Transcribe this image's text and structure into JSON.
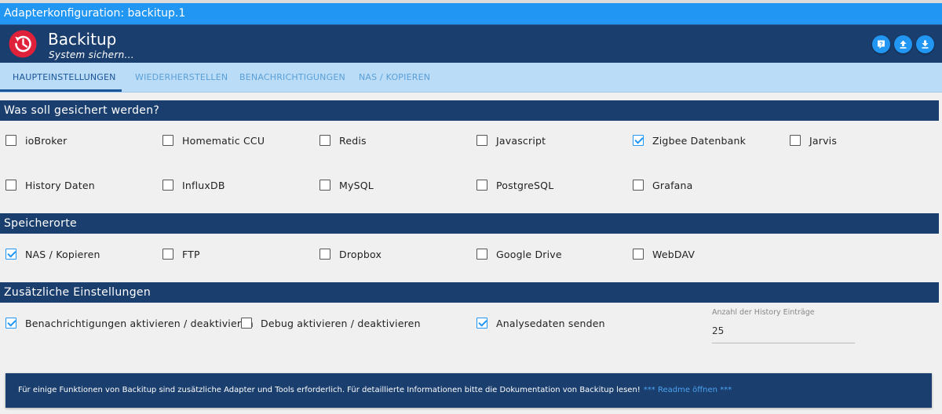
{
  "window_title": "Adapterkonfiguration: backitup.1",
  "app": {
    "name": "Backitup",
    "subtitle": "System sichern..."
  },
  "header_buttons": [
    {
      "icon": "help-icon"
    },
    {
      "icon": "upload-icon"
    },
    {
      "icon": "download-icon"
    }
  ],
  "colors": {
    "accent": "#2196f3",
    "header": "#1a3e6e",
    "tabs_bg": "#bbdcf7",
    "logo": "#e0213a"
  },
  "tabs": [
    {
      "label": "HAUPTEINSTELLUNGEN",
      "active": true
    },
    {
      "label": "WIEDERHERSTELLEN",
      "active": false
    },
    {
      "label": "BENACHRICHTIGUNGEN",
      "active": false
    },
    {
      "label": "NAS / KOPIEREN",
      "active": false
    }
  ],
  "sections": {
    "backup": {
      "title": "Was soll gesichert werden?",
      "options": [
        {
          "label": "ioBroker",
          "checked": false
        },
        {
          "label": "Homematic CCU",
          "checked": false
        },
        {
          "label": "Redis",
          "checked": false
        },
        {
          "label": "Javascript",
          "checked": false
        },
        {
          "label": "Zigbee Datenbank",
          "checked": true
        },
        {
          "label": "Jarvis",
          "checked": false
        },
        {
          "label": "History Daten",
          "checked": false
        },
        {
          "label": "InfluxDB",
          "checked": false
        },
        {
          "label": "MySQL",
          "checked": false
        },
        {
          "label": "PostgreSQL",
          "checked": false
        },
        {
          "label": "Grafana",
          "checked": false
        }
      ]
    },
    "storage": {
      "title": "Speicherorte",
      "options": [
        {
          "label": "NAS / Kopieren",
          "checked": true
        },
        {
          "label": "FTP",
          "checked": false
        },
        {
          "label": "Dropbox",
          "checked": false
        },
        {
          "label": "Google Drive",
          "checked": false
        },
        {
          "label": "WebDAV",
          "checked": false
        }
      ]
    },
    "extra": {
      "title": "Zusätzliche Einstellungen",
      "options": [
        {
          "label": "Benachrichtigungen aktivieren / deaktivieren",
          "checked": true
        },
        {
          "label": "Debug aktivieren / deaktivieren",
          "checked": false
        },
        {
          "label": "Analysedaten senden",
          "checked": true
        }
      ],
      "history_field": {
        "label": "Anzahl der History Einträge",
        "value": "25"
      }
    }
  },
  "info": {
    "text": "Für einige Funktionen von Backitup sind zusätzliche Adapter und Tools erforderlich. Für detaillierte Informationen bitte die Dokumentation von Backitup lesen!",
    "link": "*** Readme öffnen ***"
  }
}
